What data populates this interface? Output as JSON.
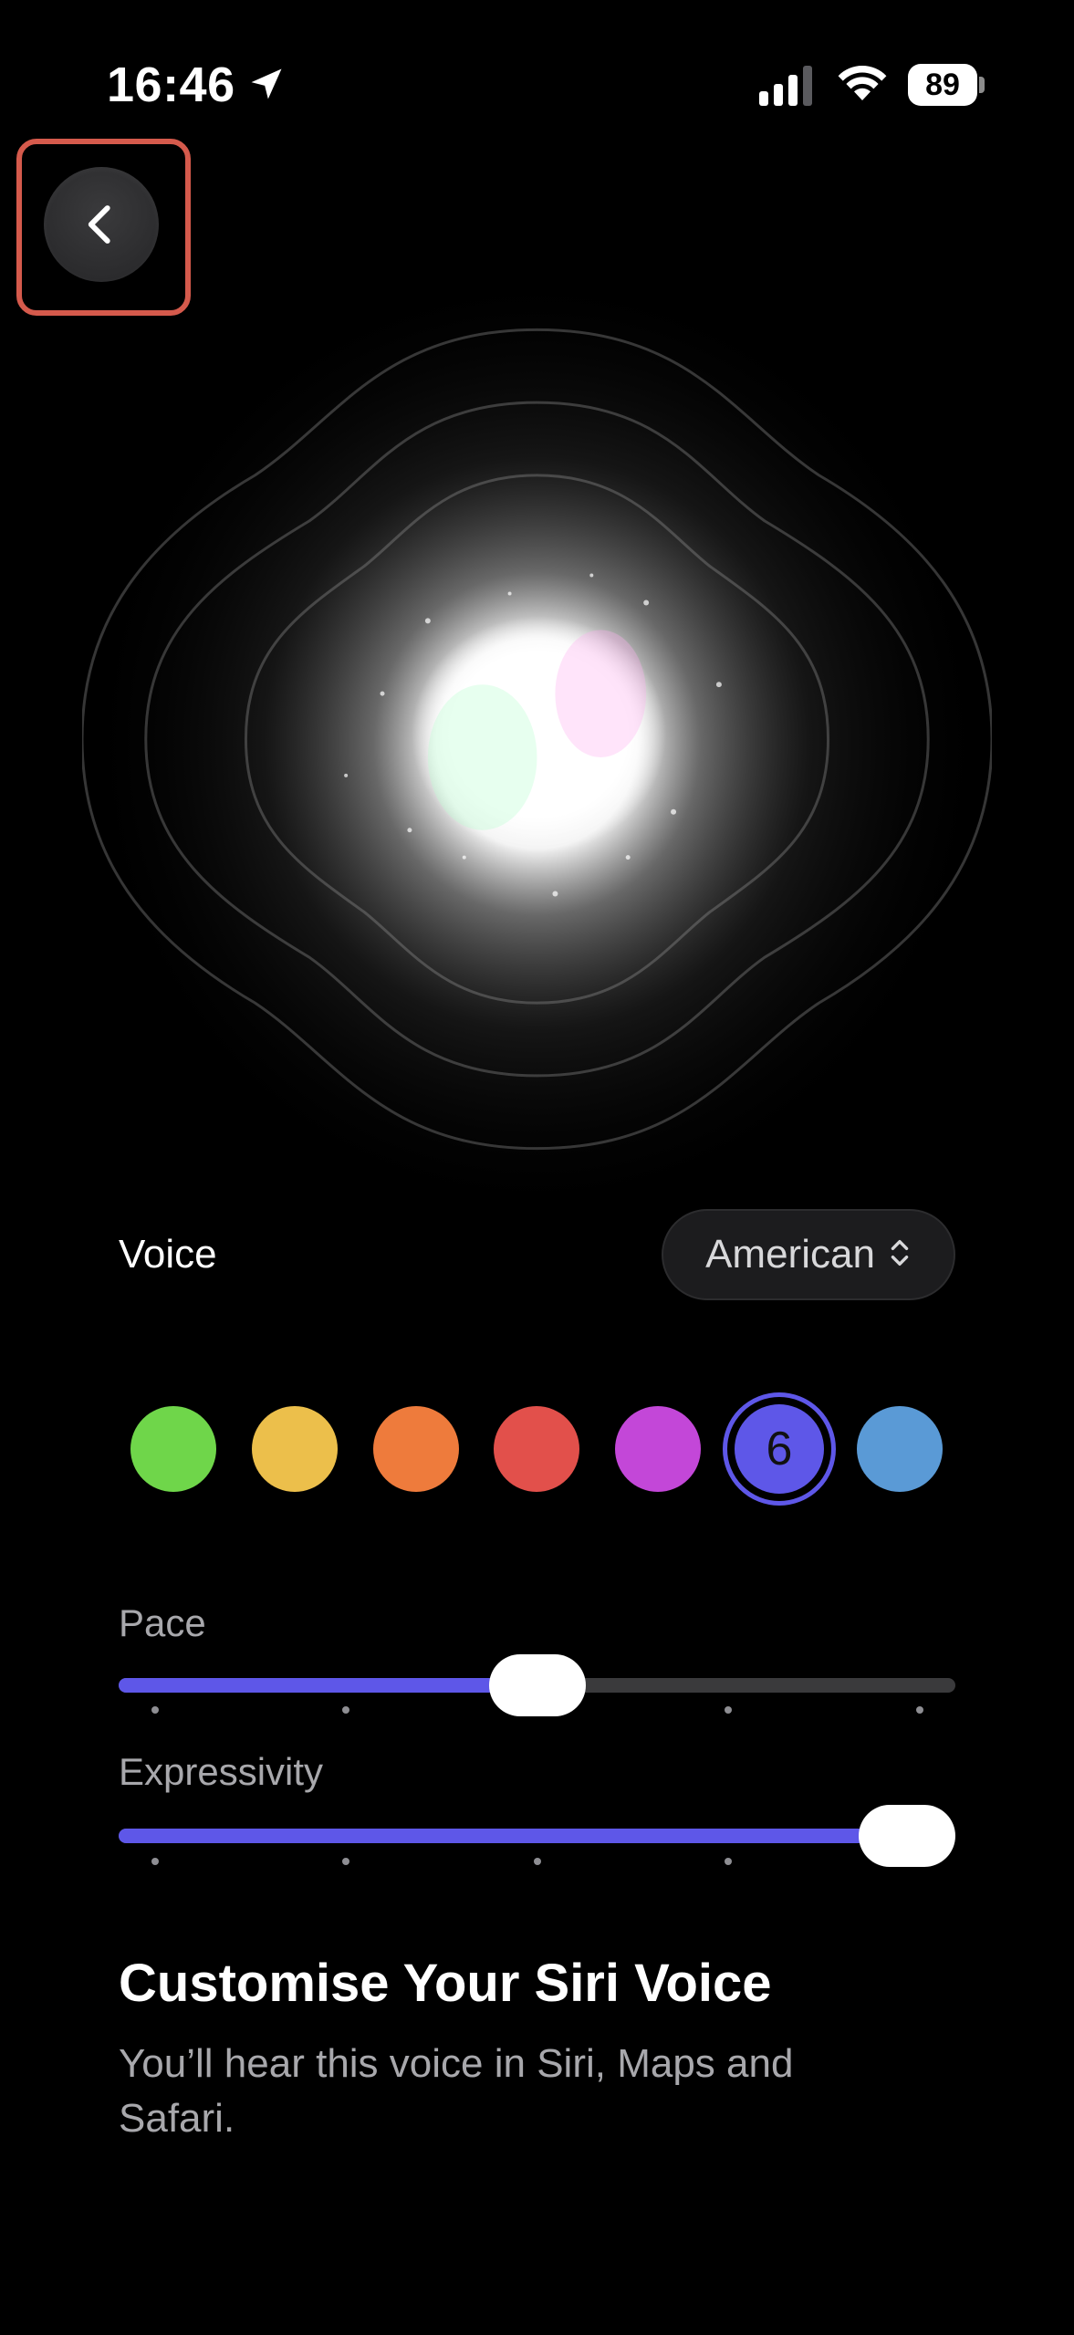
{
  "status_bar": {
    "time": "16:46",
    "battery_level": "89",
    "icons": [
      "location-arrow-icon",
      "cellular-signal-icon",
      "wifi-icon",
      "battery-icon"
    ]
  },
  "back_button": {
    "icon": "chevron-left-icon"
  },
  "voice": {
    "label": "Voice",
    "selected_variety": "American",
    "select_icon": "chevron-updown-icon"
  },
  "voice_options": {
    "colors": [
      "#6fd64a",
      "#ecbf4b",
      "#ee7b3c",
      "#e2504b",
      "#c347d8",
      "#5e57e8",
      "#5a9ad6"
    ],
    "selected_number": "6",
    "accent": "#5e57e8"
  },
  "pace": {
    "label": "Pace",
    "value_fraction": 0.5
  },
  "expressivity": {
    "label": "Expressivity",
    "value_fraction": 1.0
  },
  "info": {
    "title": "Customise Your Siri Voice",
    "description": "You’ll hear this voice in Siri, Maps and Safari."
  }
}
